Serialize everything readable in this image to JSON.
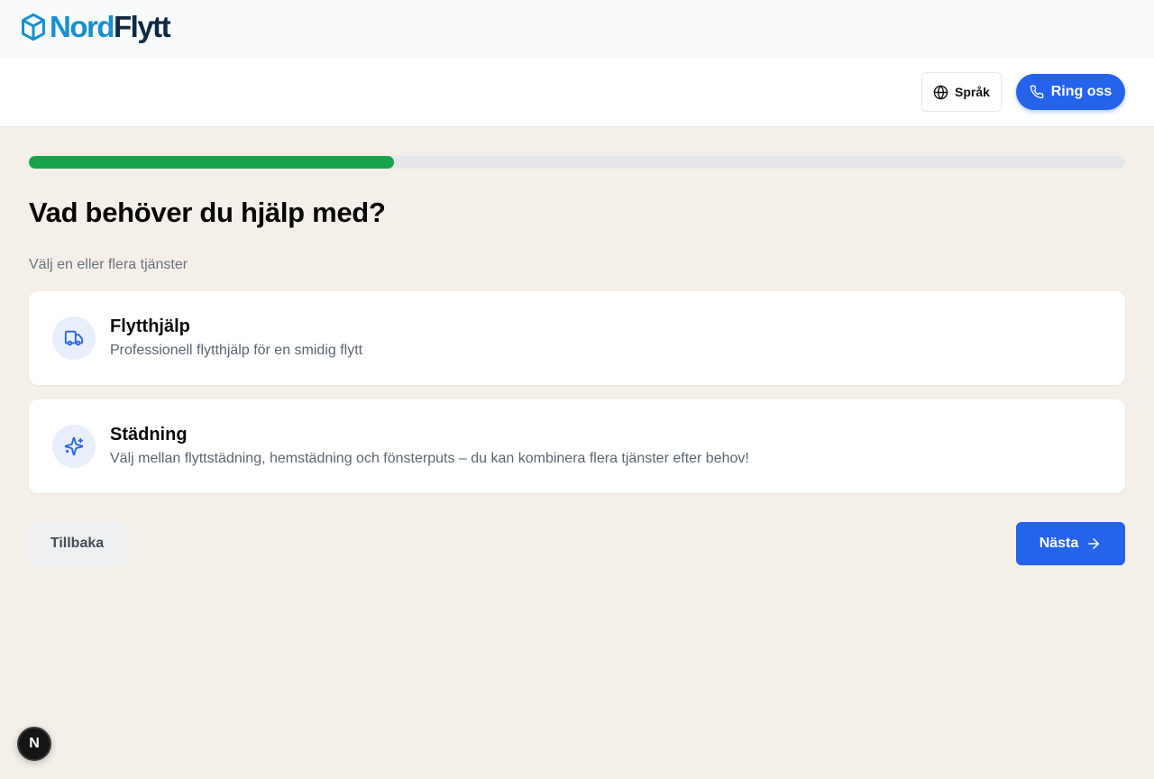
{
  "brand": {
    "name_part1": "Nord",
    "name_part2": "Flytt",
    "icon": "box-icon"
  },
  "header": {
    "language_button": {
      "label": "Språk",
      "icon": "globe-icon"
    },
    "call_button": {
      "label": "Ring oss",
      "icon": "phone-icon"
    }
  },
  "progress": {
    "value_percent": 33.3,
    "color": "#16a34a",
    "track_color": "#e5e7eb"
  },
  "main": {
    "title": "Vad behöver du hjälp med?",
    "subtitle": "Välj en eller flera tjänster",
    "services": [
      {
        "title": "Flytthjälp",
        "description": "Professionell flytthjälp för en smidig flytt",
        "icon": "truck-icon"
      },
      {
        "title": "Städning",
        "description": "Välj mellan flyttstädning, hemstädning och fönsterputs – du kan kombinera flera tjänster efter behov!",
        "icon": "sparkles-icon"
      }
    ]
  },
  "navigation": {
    "back_label": "Tillbaka",
    "next_label": "Nästa",
    "next_icon": "arrow-right-icon"
  },
  "dev_badge": {
    "label": "N"
  },
  "colors": {
    "accent": "#2563eb",
    "brand_light": "#1690cf",
    "brand_dark": "#0f2a43",
    "background": "#f4f0e9"
  }
}
